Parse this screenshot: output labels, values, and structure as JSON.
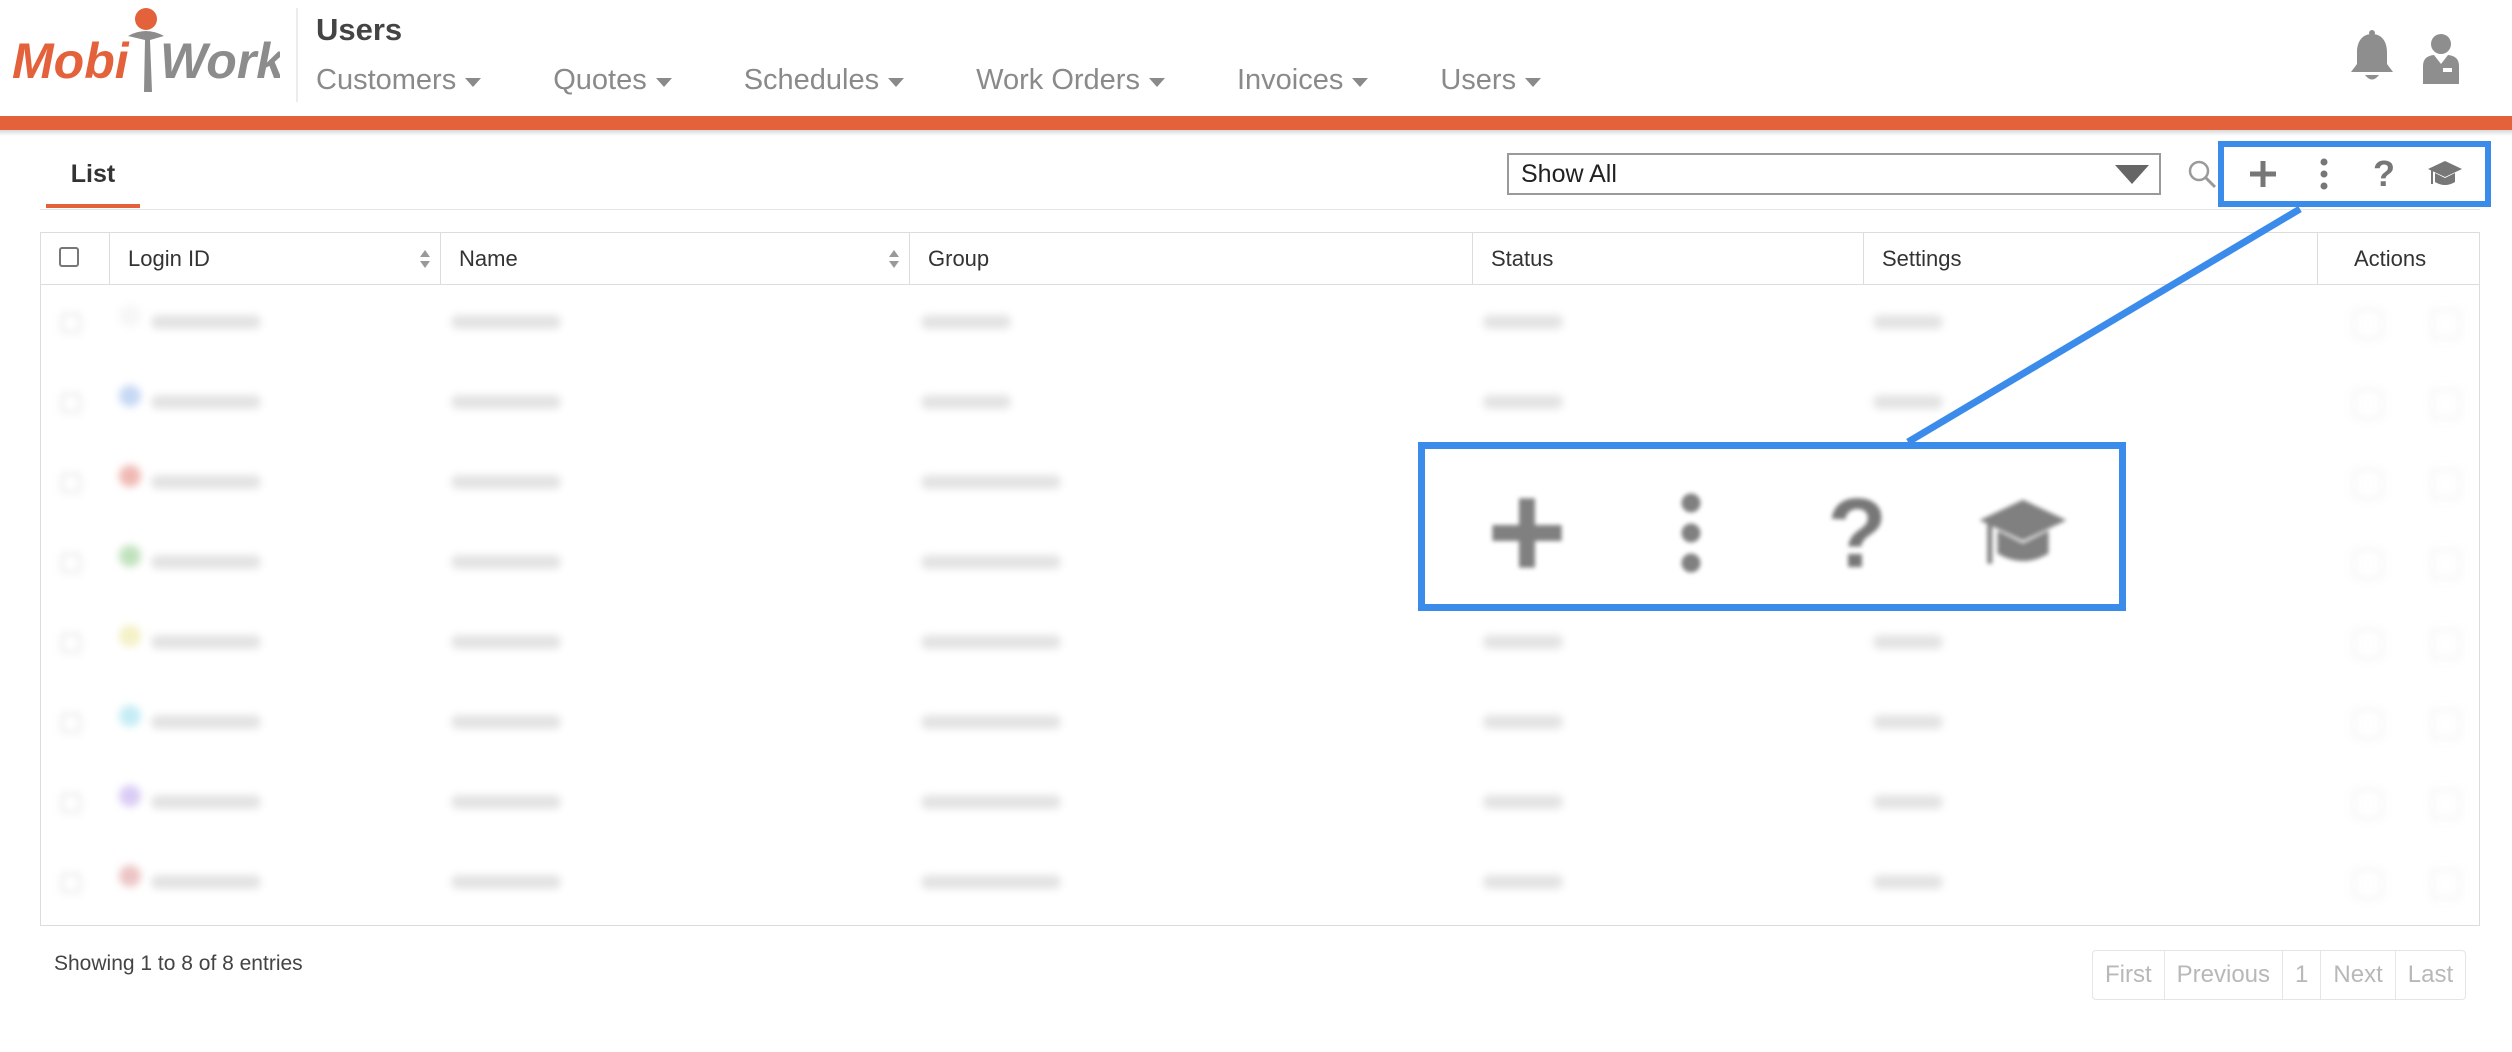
{
  "app": {
    "logo_text_left": "Mobi",
    "logo_text_right": "Work",
    "page_title": "Users",
    "accent_color": "#e4623b",
    "highlight_color": "#3b8beb"
  },
  "nav": {
    "items": [
      {
        "label": "Customers"
      },
      {
        "label": "Quotes"
      },
      {
        "label": "Schedules"
      },
      {
        "label": "Work Orders"
      },
      {
        "label": "Invoices"
      },
      {
        "label": "Users"
      }
    ]
  },
  "header_icons": [
    "bell-icon",
    "user-icon"
  ],
  "tabs": {
    "active": "List"
  },
  "filter": {
    "selected": "Show All"
  },
  "toolbar": {
    "icons": [
      "search-icon",
      "plus-icon",
      "more-vertical-icon",
      "help-icon",
      "graduation-cap-icon"
    ],
    "help_glyph": "?"
  },
  "table": {
    "columns": [
      "Login ID",
      "Name",
      "Group",
      "Status",
      "Settings",
      "Actions"
    ],
    "row_count": 8,
    "avatar_colors": [
      "#f2f2f2",
      "#a9c4ee",
      "#e8938a",
      "#9fd39a",
      "#efe9a8",
      "#a7e3ef",
      "#c6b1ef",
      "#e2a6a6"
    ]
  },
  "footer": {
    "info": "Showing 1 to 8 of 8 entries",
    "pagination": [
      "First",
      "Previous",
      "1",
      "Next",
      "Last"
    ]
  },
  "callout": {
    "icons": [
      "plus-icon",
      "more-vertical-icon",
      "help-icon",
      "graduation-cap-icon"
    ],
    "help_glyph": "?"
  }
}
